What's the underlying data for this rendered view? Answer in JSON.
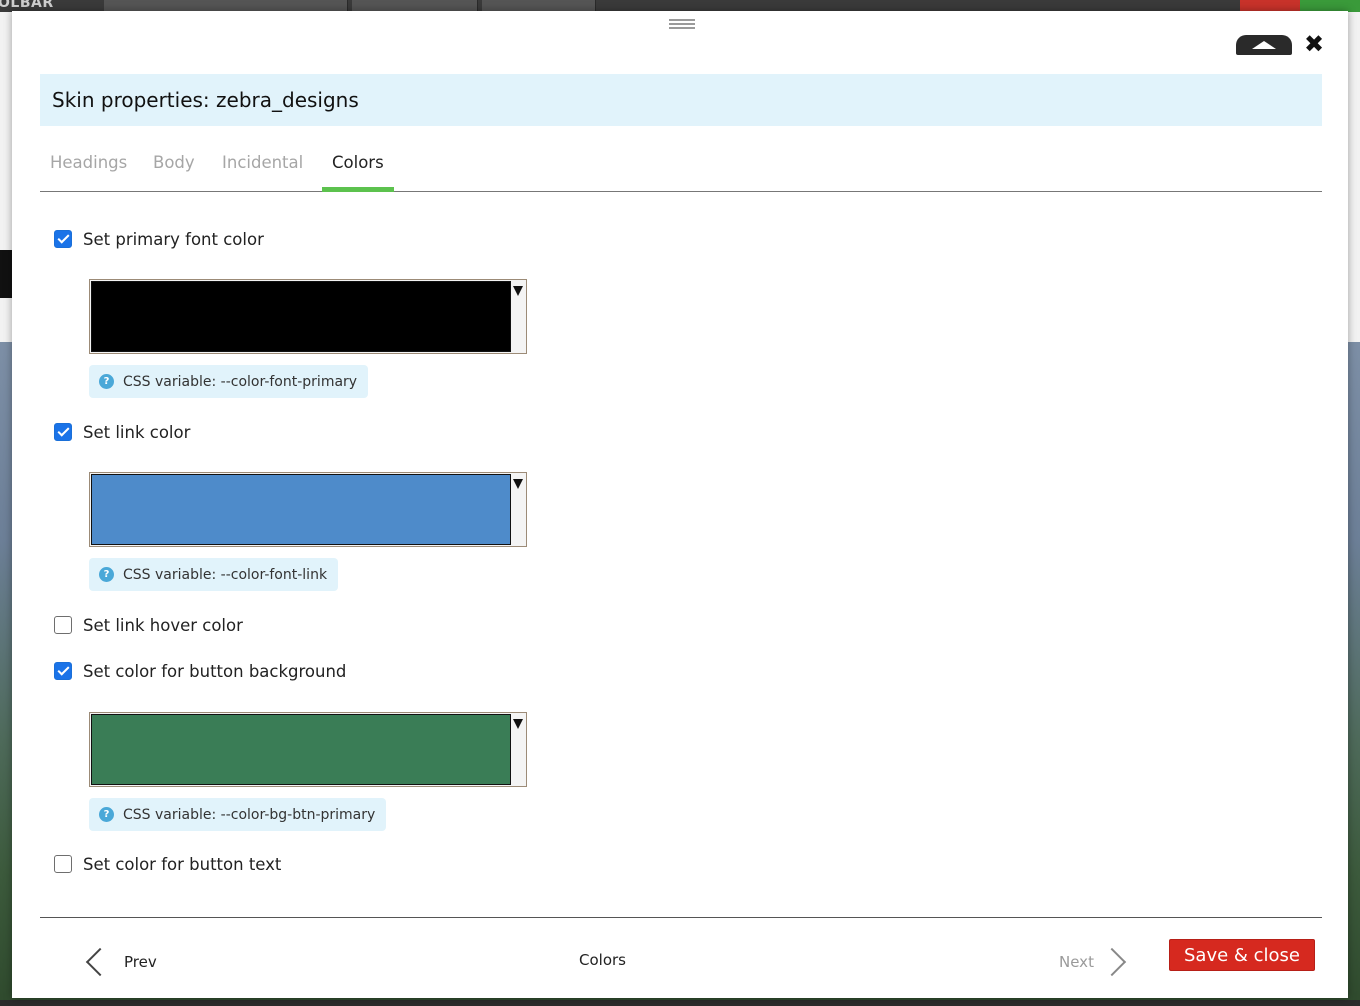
{
  "background": {
    "toolbar_label": "OLBAR"
  },
  "modal": {
    "title": "Skin properties: zebra_designs",
    "tabs": [
      {
        "label": "Headings",
        "active": false
      },
      {
        "label": "Body",
        "active": false
      },
      {
        "label": "Incidental",
        "active": false
      },
      {
        "label": "Colors",
        "active": true
      }
    ],
    "options": [
      {
        "label": "Set primary font color",
        "checked": true,
        "color": "#000000",
        "css_variable": "CSS variable: --color-font-primary"
      },
      {
        "label": "Set link color",
        "checked": true,
        "color": "#4e8bca",
        "css_variable": "CSS variable: --color-font-link"
      },
      {
        "label": "Set link hover color",
        "checked": false
      },
      {
        "label": "Set color for button background",
        "checked": true,
        "color": "#3a7d56",
        "css_variable": "CSS variable: --color-bg-btn-primary"
      },
      {
        "label": "Set color for button text",
        "checked": false
      }
    ],
    "help_icon_glyph": "?",
    "close_glyph": "✖",
    "footer": {
      "prev_label": "Prev",
      "current_label": "Colors",
      "next_label": "Next",
      "save_label": "Save & close"
    }
  },
  "colors": {
    "accent_tab": "#5cc24e",
    "save_button": "#d6291f",
    "title_bar_bg": "#e1f3fb",
    "checkbox_checked": "#1a73e8"
  },
  "icons": {
    "drag": "drag-handle-icon",
    "collapse": "collapse-up-icon",
    "close": "close-icon",
    "help": "help-icon",
    "prev": "chevron-left-icon",
    "next": "chevron-right-icon",
    "dropdown": "dropdown-arrow-icon"
  }
}
